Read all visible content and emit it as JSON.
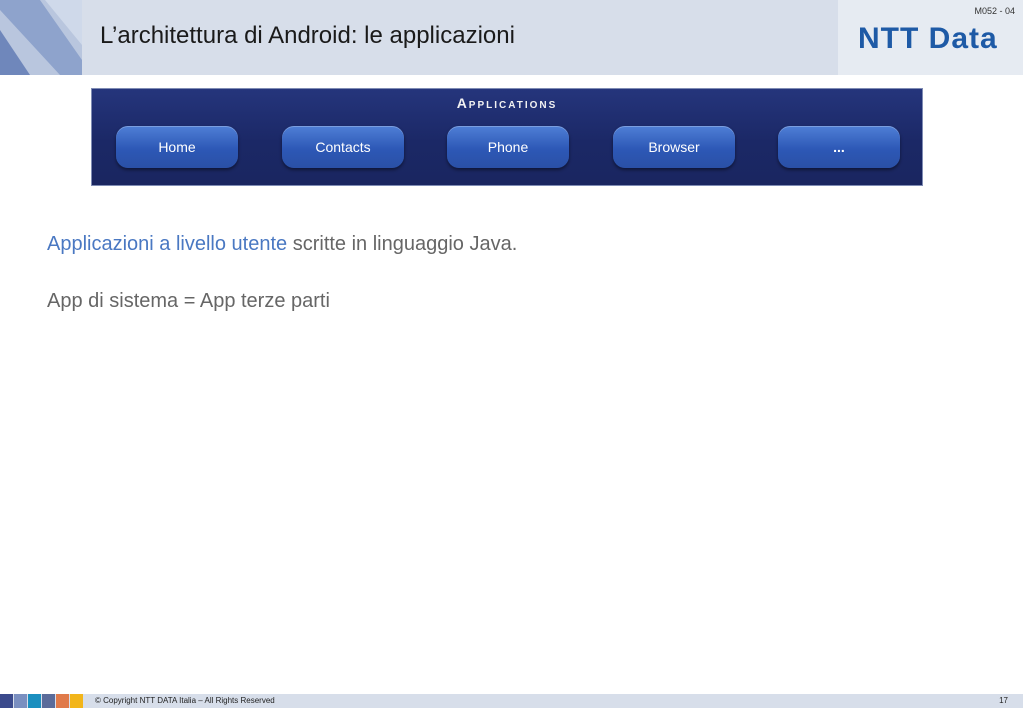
{
  "header": {
    "title": "L’architettura di Android: le applicazioni",
    "slide_code": "M052 - 04",
    "logo_main": "NTT",
    "logo_data": "Data",
    "colors": {
      "band": "#d7deea",
      "logo": "#1e5aa6"
    }
  },
  "applications": {
    "title": "Applications",
    "buttons": [
      "Home",
      "Contacts",
      "Phone",
      "Browser",
      "..."
    ]
  },
  "body": {
    "line1_highlight": "Applicazioni a livello utente",
    "line1_rest": " scritte in linguaggio Java.",
    "line2": "App di sistema = App terze parti"
  },
  "footer": {
    "copyright": "© Copyright NTT DATA Italia – All Rights Reserved",
    "page_number": "17",
    "color_squares": [
      "#3b4a8c",
      "#7a8fc0",
      "#1b8fbf",
      "#5a6b9a",
      "#e07a4a",
      "#f2b51a"
    ]
  }
}
